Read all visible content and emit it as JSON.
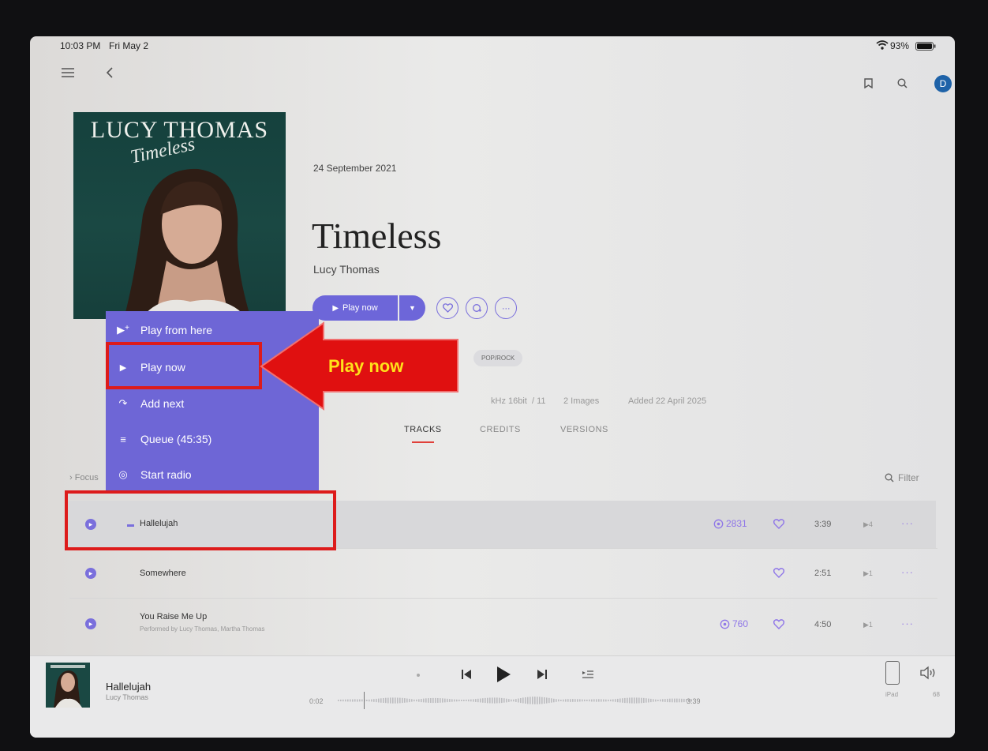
{
  "status_bar": {
    "time": "10:03 PM",
    "date": "Fri May 2",
    "battery": "93%"
  },
  "header": {
    "avatar_letter": "D"
  },
  "album": {
    "cover_artist": "LUCY THOMAS",
    "cover_title": "Timeless",
    "release_date": "24 September 2021",
    "title": "Timeless",
    "artist": "Lucy Thomas",
    "play_label": "Play now",
    "genre_tag": "POP/ROCK",
    "meta": {
      "format": "kHz 16bit",
      "tracks": "/ 11",
      "images": "2 Images",
      "added": "Added 22 April 2025"
    }
  },
  "tabs": [
    {
      "label": "TRACKS"
    },
    {
      "label": "CREDITS"
    },
    {
      "label": "VERSIONS"
    }
  ],
  "focus_label": "Focus",
  "filter_label": "Filter",
  "menu": {
    "items": [
      {
        "label": "Play from here"
      },
      {
        "label": "Play now"
      },
      {
        "label": "Add next"
      },
      {
        "label": "Queue (45:35)"
      },
      {
        "label": "Start radio"
      }
    ]
  },
  "annotation": {
    "label": "Play now"
  },
  "tracks": [
    {
      "title": "Hallelujah",
      "subtitle": "",
      "plays": "2831",
      "duration": "3:39",
      "versions": "4"
    },
    {
      "title": "Somewhere",
      "subtitle": "",
      "plays": "",
      "duration": "2:51",
      "versions": "1"
    },
    {
      "title": "You Raise Me Up",
      "subtitle": "Performed by Lucy Thomas, Martha Thomas",
      "plays": "760",
      "duration": "4:50",
      "versions": "1"
    }
  ],
  "player": {
    "title": "Hallelujah",
    "artist": "Lucy Thomas",
    "elapsed": "0:02",
    "total": "3:39",
    "progress": 0.01,
    "device": "iPad",
    "volume": "68"
  },
  "colors": {
    "accent": "#6d66d9",
    "menu": "#6e66d6",
    "annotation": "#e01010",
    "heart": "#8f76e8"
  }
}
